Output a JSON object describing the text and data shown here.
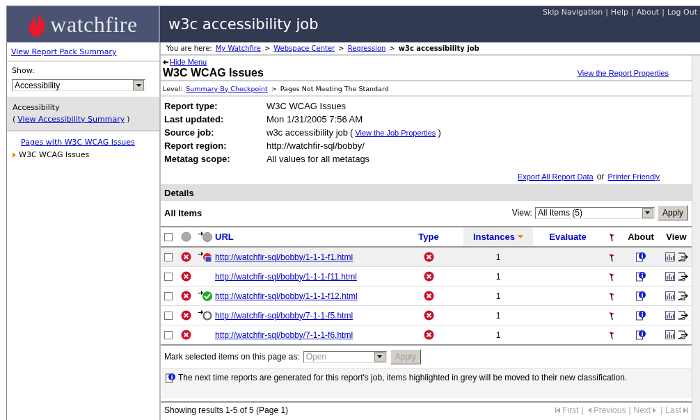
{
  "logo": {
    "text": "watchfire"
  },
  "header": {
    "title": "w3c accessibility job",
    "separator": "|",
    "links": [
      "Skip Navigation",
      "Help",
      "About",
      "Log Out"
    ]
  },
  "sidebar": {
    "summary_link": "View Report Pack Summary",
    "show_label": "Show:",
    "show_value": "Accessibility",
    "section_title": "Accessibility",
    "open_paren": "(",
    "section_link": "View Accessibility Summary",
    "close_paren": ")",
    "items": [
      {
        "label": "Pages with W3C WCAG Issues",
        "selected": false
      },
      {
        "label": "W3C WCAG Issues",
        "selected": true
      }
    ]
  },
  "breadcrumb": {
    "prefix": "You are here:",
    "separator": ">",
    "links": [
      "My Watchfire",
      "Webspace Center",
      "Regression"
    ],
    "current": "w3c accessibility job"
  },
  "hide_menu": "Hide Menu",
  "report": {
    "title": "W3C WCAG Issues",
    "properties_link": "View the Report Properties",
    "level_label": "Level:",
    "level_link": "Summary By Checkpoint",
    "level_separator": ">",
    "level_current": "Pages Not Meeting The Standard",
    "meta": [
      {
        "label": "Report type:",
        "value": "W3C WCAG Issues"
      },
      {
        "label": "Last updated:",
        "value": "Mon 1/31/2005 7:56 AM"
      },
      {
        "label": "Source job:",
        "value": "w3c accessibility job",
        "open_paren": "(",
        "link": "View the Job Properties",
        "close_paren": ")"
      },
      {
        "label": "Report region:",
        "value": "http://watchfir-sql/bobby/"
      },
      {
        "label": "Metatag scope:",
        "value": "All values for all metatags"
      }
    ],
    "export_link": "Export All Report Data",
    "export_or": "or",
    "printer_link": "Printer Friendly"
  },
  "details": {
    "title": "Details",
    "subtitle": "All Items",
    "view_label": "View:",
    "view_value": "All Items (5)",
    "apply": "Apply"
  },
  "table": {
    "select_all_checked": false,
    "columns": [
      "URL",
      "Type",
      "Instances",
      "Evaluate",
      "About",
      "View"
    ],
    "rows": [
      {
        "checked": false,
        "highlighted": true,
        "kind": "new",
        "url": "http://watchfir-sql/bobby/1-1-1-f1.html",
        "instances": "1"
      },
      {
        "checked": false,
        "highlighted": false,
        "kind": "plain",
        "url": "http://watchfir-sql/bobby/1-1-1-f11.html",
        "instances": "1"
      },
      {
        "checked": false,
        "highlighted": false,
        "kind": "passed",
        "url": "http://watchfir-sql/bobby/1-1-1-f12.html",
        "instances": "1"
      },
      {
        "checked": false,
        "highlighted": false,
        "kind": "ignored",
        "url": "http://watchfir-sql/bobby/7-1-1-f5.html",
        "instances": "1"
      },
      {
        "checked": false,
        "highlighted": false,
        "kind": "plain",
        "url": "http://watchfir-sql/bobby/7-1-1-f6.html",
        "instances": "1"
      }
    ]
  },
  "mark": {
    "label": "Mark selected items on this page as:",
    "value": "Open",
    "apply": "Apply",
    "disabled": true
  },
  "info": "The next time reports are generated for this report's job, items highlighted in grey will be moved to their new classification.",
  "footer": {
    "results": "Showing results 1-5 of 5 (Page 1)",
    "separator": "|",
    "pager": [
      {
        "label": "First",
        "disabled": true
      },
      {
        "label": "Previous",
        "disabled": true
      },
      {
        "label": "Next",
        "disabled": true
      },
      {
        "label": "Last",
        "disabled": true
      }
    ]
  }
}
